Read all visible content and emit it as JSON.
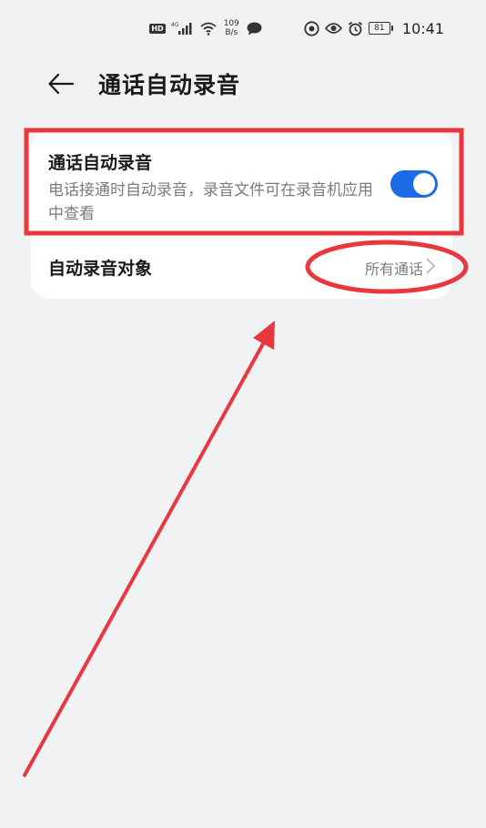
{
  "status_bar": {
    "hd": "HD",
    "network": "4G",
    "net_speed_value": "109",
    "net_speed_unit": "B/s",
    "battery": "81",
    "time": "10:41"
  },
  "header": {
    "title": "通话自动录音"
  },
  "settings": {
    "auto_record": {
      "title": "通话自动录音",
      "description": "电话接通时自动录音，录音文件可在录音机应用中查看",
      "enabled": true
    },
    "record_target": {
      "title": "自动录音对象",
      "value": "所有通话"
    }
  },
  "colors": {
    "accent": "#1c6ce8",
    "annotation": "#e8383d",
    "background": "#f1f2f4"
  }
}
